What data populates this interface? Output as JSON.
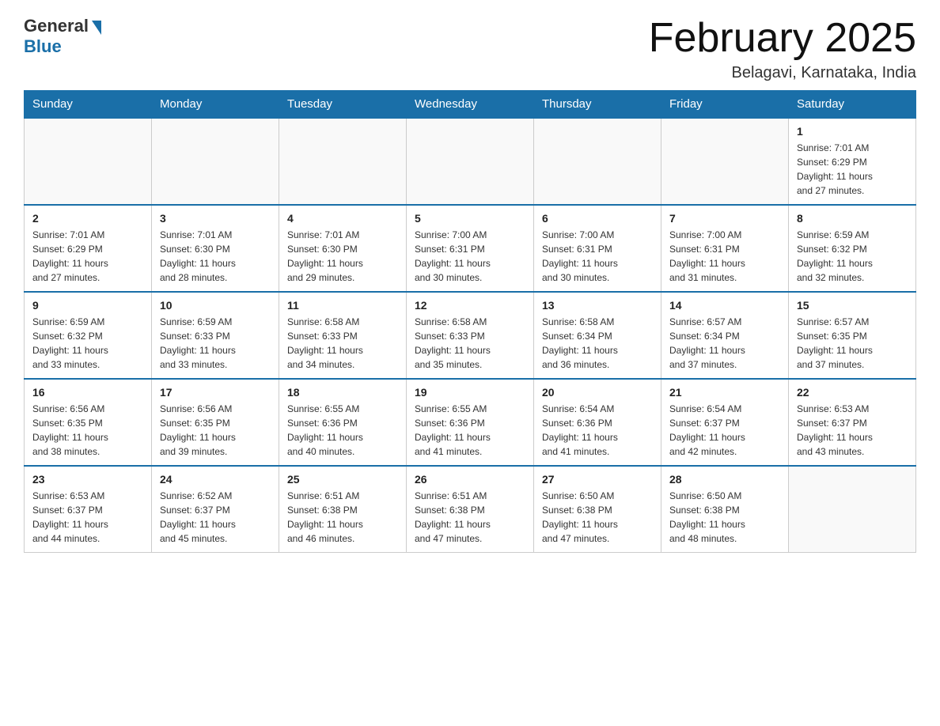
{
  "header": {
    "logo_general": "General",
    "logo_blue": "Blue",
    "title": "February 2025",
    "subtitle": "Belagavi, Karnataka, India"
  },
  "weekdays": [
    "Sunday",
    "Monday",
    "Tuesday",
    "Wednesday",
    "Thursday",
    "Friday",
    "Saturday"
  ],
  "weeks": [
    [
      {
        "day": "",
        "info": ""
      },
      {
        "day": "",
        "info": ""
      },
      {
        "day": "",
        "info": ""
      },
      {
        "day": "",
        "info": ""
      },
      {
        "day": "",
        "info": ""
      },
      {
        "day": "",
        "info": ""
      },
      {
        "day": "1",
        "info": "Sunrise: 7:01 AM\nSunset: 6:29 PM\nDaylight: 11 hours\nand 27 minutes."
      }
    ],
    [
      {
        "day": "2",
        "info": "Sunrise: 7:01 AM\nSunset: 6:29 PM\nDaylight: 11 hours\nand 27 minutes."
      },
      {
        "day": "3",
        "info": "Sunrise: 7:01 AM\nSunset: 6:30 PM\nDaylight: 11 hours\nand 28 minutes."
      },
      {
        "day": "4",
        "info": "Sunrise: 7:01 AM\nSunset: 6:30 PM\nDaylight: 11 hours\nand 29 minutes."
      },
      {
        "day": "5",
        "info": "Sunrise: 7:00 AM\nSunset: 6:31 PM\nDaylight: 11 hours\nand 30 minutes."
      },
      {
        "day": "6",
        "info": "Sunrise: 7:00 AM\nSunset: 6:31 PM\nDaylight: 11 hours\nand 30 minutes."
      },
      {
        "day": "7",
        "info": "Sunrise: 7:00 AM\nSunset: 6:31 PM\nDaylight: 11 hours\nand 31 minutes."
      },
      {
        "day": "8",
        "info": "Sunrise: 6:59 AM\nSunset: 6:32 PM\nDaylight: 11 hours\nand 32 minutes."
      }
    ],
    [
      {
        "day": "9",
        "info": "Sunrise: 6:59 AM\nSunset: 6:32 PM\nDaylight: 11 hours\nand 33 minutes."
      },
      {
        "day": "10",
        "info": "Sunrise: 6:59 AM\nSunset: 6:33 PM\nDaylight: 11 hours\nand 33 minutes."
      },
      {
        "day": "11",
        "info": "Sunrise: 6:58 AM\nSunset: 6:33 PM\nDaylight: 11 hours\nand 34 minutes."
      },
      {
        "day": "12",
        "info": "Sunrise: 6:58 AM\nSunset: 6:33 PM\nDaylight: 11 hours\nand 35 minutes."
      },
      {
        "day": "13",
        "info": "Sunrise: 6:58 AM\nSunset: 6:34 PM\nDaylight: 11 hours\nand 36 minutes."
      },
      {
        "day": "14",
        "info": "Sunrise: 6:57 AM\nSunset: 6:34 PM\nDaylight: 11 hours\nand 37 minutes."
      },
      {
        "day": "15",
        "info": "Sunrise: 6:57 AM\nSunset: 6:35 PM\nDaylight: 11 hours\nand 37 minutes."
      }
    ],
    [
      {
        "day": "16",
        "info": "Sunrise: 6:56 AM\nSunset: 6:35 PM\nDaylight: 11 hours\nand 38 minutes."
      },
      {
        "day": "17",
        "info": "Sunrise: 6:56 AM\nSunset: 6:35 PM\nDaylight: 11 hours\nand 39 minutes."
      },
      {
        "day": "18",
        "info": "Sunrise: 6:55 AM\nSunset: 6:36 PM\nDaylight: 11 hours\nand 40 minutes."
      },
      {
        "day": "19",
        "info": "Sunrise: 6:55 AM\nSunset: 6:36 PM\nDaylight: 11 hours\nand 41 minutes."
      },
      {
        "day": "20",
        "info": "Sunrise: 6:54 AM\nSunset: 6:36 PM\nDaylight: 11 hours\nand 41 minutes."
      },
      {
        "day": "21",
        "info": "Sunrise: 6:54 AM\nSunset: 6:37 PM\nDaylight: 11 hours\nand 42 minutes."
      },
      {
        "day": "22",
        "info": "Sunrise: 6:53 AM\nSunset: 6:37 PM\nDaylight: 11 hours\nand 43 minutes."
      }
    ],
    [
      {
        "day": "23",
        "info": "Sunrise: 6:53 AM\nSunset: 6:37 PM\nDaylight: 11 hours\nand 44 minutes."
      },
      {
        "day": "24",
        "info": "Sunrise: 6:52 AM\nSunset: 6:37 PM\nDaylight: 11 hours\nand 45 minutes."
      },
      {
        "day": "25",
        "info": "Sunrise: 6:51 AM\nSunset: 6:38 PM\nDaylight: 11 hours\nand 46 minutes."
      },
      {
        "day": "26",
        "info": "Sunrise: 6:51 AM\nSunset: 6:38 PM\nDaylight: 11 hours\nand 47 minutes."
      },
      {
        "day": "27",
        "info": "Sunrise: 6:50 AM\nSunset: 6:38 PM\nDaylight: 11 hours\nand 47 minutes."
      },
      {
        "day": "28",
        "info": "Sunrise: 6:50 AM\nSunset: 6:38 PM\nDaylight: 11 hours\nand 48 minutes."
      },
      {
        "day": "",
        "info": ""
      }
    ]
  ]
}
